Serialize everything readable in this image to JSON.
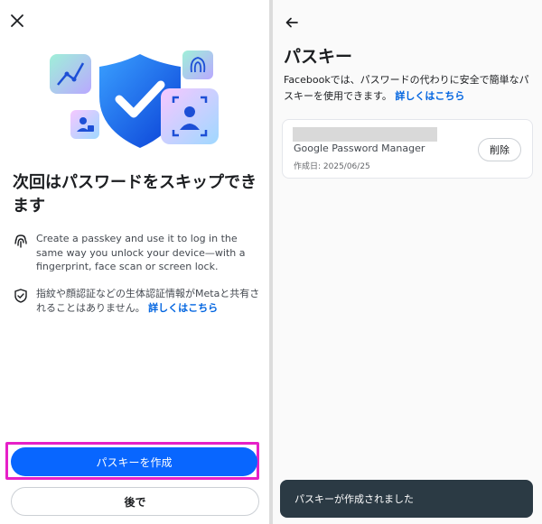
{
  "left": {
    "title": "次回はパスワードをスキップできます",
    "info1": "Create a passkey and use it to log in the same way you unlock your device—with a fingerprint, face scan or screen lock.",
    "info2_text": "指紋や顔認証などの生体認証情報がMetaと共有されることはありません。",
    "info2_link": "詳しくはこちら",
    "primary_button": "パスキーを作成",
    "secondary_button": "後で",
    "icons": {
      "close": "close-icon",
      "fingerprint": "fingerprint-icon",
      "shield": "shield-check-icon"
    }
  },
  "right": {
    "title": "パスキー",
    "description": "Facebookでは、パスワードの代わりに安全で簡単なパスキーを使用できます。",
    "description_link": "詳しくはこちら",
    "passkey": {
      "provider": "Google Password Manager",
      "created": "作成日: 2025/06/25",
      "delete_label": "削除"
    },
    "toast": "パスキーが作成されました",
    "icons": {
      "back": "back-arrow-icon"
    }
  },
  "colors": {
    "primary": "#0866ff",
    "link": "#0064e0",
    "highlight": "#e620c8",
    "toast_bg": "#2b3a44"
  }
}
